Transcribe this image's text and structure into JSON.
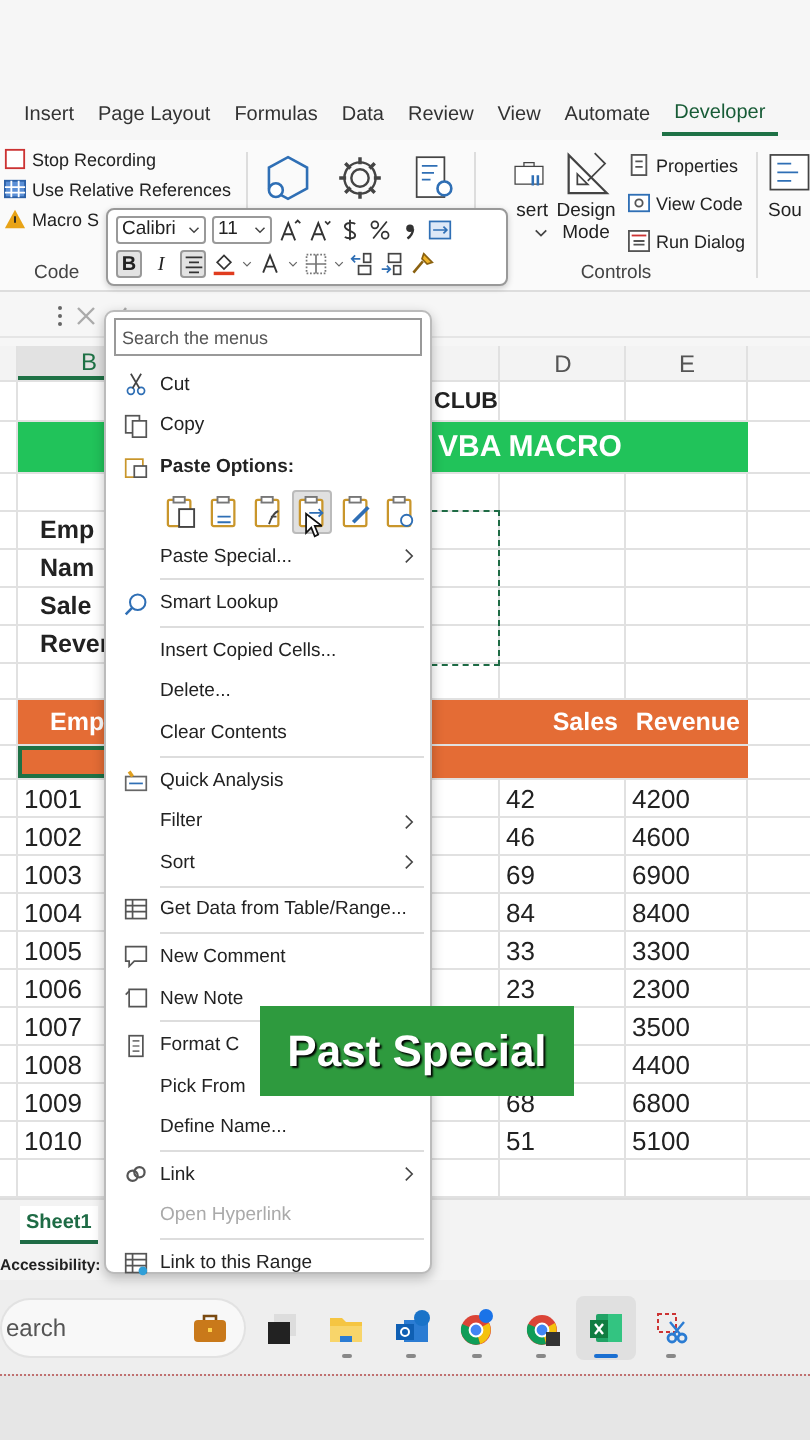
{
  "ribbon": {
    "tabs": [
      {
        "label": "Insert",
        "selected": false
      },
      {
        "label": "Page Layout",
        "selected": false
      },
      {
        "label": "Formulas",
        "selected": false
      },
      {
        "label": "Data",
        "selected": false
      },
      {
        "label": "Review",
        "selected": false
      },
      {
        "label": "View",
        "selected": false
      },
      {
        "label": "Automate",
        "selected": false
      },
      {
        "label": "Developer",
        "selected": true
      }
    ],
    "code_group": {
      "buttons": [
        "Stop Recording",
        "Use Relative References",
        "Macro S"
      ],
      "label": "Code"
    },
    "controls_group": {
      "large_buttons": [
        "sert",
        "Design Mode"
      ],
      "small_buttons": [
        "Properties",
        "View Code",
        "Run Dialog"
      ],
      "label": "Controls"
    },
    "next_group": {
      "button": "Sou"
    }
  },
  "mini_toolbar": {
    "font": "Calibri",
    "size": "11",
    "bold": {
      "label": "B",
      "on": true
    },
    "italic": {
      "label": "I",
      "on": false
    },
    "center": {
      "on": true
    }
  },
  "sheet": {
    "columns": [
      {
        "label": "B",
        "selected": true
      },
      {
        "label": "D",
        "selected": false
      },
      {
        "label": "E",
        "selected": false
      }
    ],
    "banner_text": "CLUB",
    "title": "VBA MACRO",
    "fields": [
      "Emp",
      "Nam",
      "Sale",
      "Rever"
    ],
    "headers": [
      "Emp",
      "Sales",
      "Revenue"
    ],
    "rows": [
      {
        "id": "1001",
        "sales": "42",
        "revenue": "4200"
      },
      {
        "id": "1002",
        "sales": "46",
        "revenue": "4600"
      },
      {
        "id": "1003",
        "sales": "69",
        "revenue": "6900"
      },
      {
        "id": "1004",
        "sales": "84",
        "revenue": "8400"
      },
      {
        "id": "1005",
        "sales": "33",
        "revenue": "3300"
      },
      {
        "id": "1006",
        "sales": "23",
        "revenue": "2300"
      },
      {
        "id": "1007",
        "revenue": "3500"
      },
      {
        "id": "1008",
        "revenue": "4400"
      },
      {
        "id": "1009",
        "sales": "68",
        "revenue": "6800"
      },
      {
        "id": "1010",
        "sales": "51",
        "revenue": "5100"
      }
    ]
  },
  "context_menu": {
    "search": {
      "placeholder": "Search the menus"
    },
    "items": [
      {
        "kind": "item",
        "label": "Cut"
      },
      {
        "kind": "item",
        "label": "Copy"
      },
      {
        "kind": "header",
        "label": "Paste Options:"
      },
      {
        "kind": "paste-row",
        "options": [
          {
            "selected": false
          },
          {
            "selected": false
          },
          {
            "selected": false
          },
          {
            "selected": true
          },
          {
            "selected": false
          },
          {
            "selected": false
          }
        ]
      },
      {
        "kind": "item",
        "label": "Paste Special...",
        "submenu": true
      },
      {
        "kind": "separator"
      },
      {
        "kind": "item",
        "label": "Smart Lookup"
      },
      {
        "kind": "separator"
      },
      {
        "kind": "item",
        "label": "Insert Copied Cells..."
      },
      {
        "kind": "item",
        "label": "Delete..."
      },
      {
        "kind": "item",
        "label": "Clear Contents"
      },
      {
        "kind": "separator"
      },
      {
        "kind": "item",
        "label": "Quick Analysis"
      },
      {
        "kind": "item",
        "label": "Filter",
        "submenu": true
      },
      {
        "kind": "item",
        "label": "Sort",
        "submenu": true
      },
      {
        "kind": "separator"
      },
      {
        "kind": "item",
        "label": "Get Data from Table/Range..."
      },
      {
        "kind": "separator"
      },
      {
        "kind": "item",
        "label": "New Comment"
      },
      {
        "kind": "item",
        "label": "New Note"
      },
      {
        "kind": "separator"
      },
      {
        "kind": "item",
        "label": "Format C"
      },
      {
        "kind": "item",
        "label": "Pick From"
      },
      {
        "kind": "item",
        "label": "Define Name..."
      },
      {
        "kind": "separator"
      },
      {
        "kind": "item",
        "label": "Link",
        "submenu": true
      },
      {
        "kind": "item",
        "label": "Open Hyperlink",
        "disabled": true
      },
      {
        "kind": "separator"
      },
      {
        "kind": "item",
        "label": "Link to this Range"
      }
    ]
  },
  "caption": "Past Special",
  "sheet_tabs": [
    {
      "label": "Sheet1",
      "selected": true
    }
  ],
  "status_bar": {
    "accessibility": "Accessibility:"
  },
  "taskbar": {
    "search": {
      "placeholder": "earch"
    },
    "apps": [
      {
        "running": false,
        "selected": false
      },
      {
        "running": false,
        "selected": false
      },
      {
        "running": true,
        "selected": false
      },
      {
        "running": true,
        "selected": false
      },
      {
        "running": true,
        "selected": false
      },
      {
        "running": true,
        "selected": false
      },
      {
        "running": true,
        "selected": true
      },
      {
        "running": true,
        "selected": false
      }
    ]
  }
}
